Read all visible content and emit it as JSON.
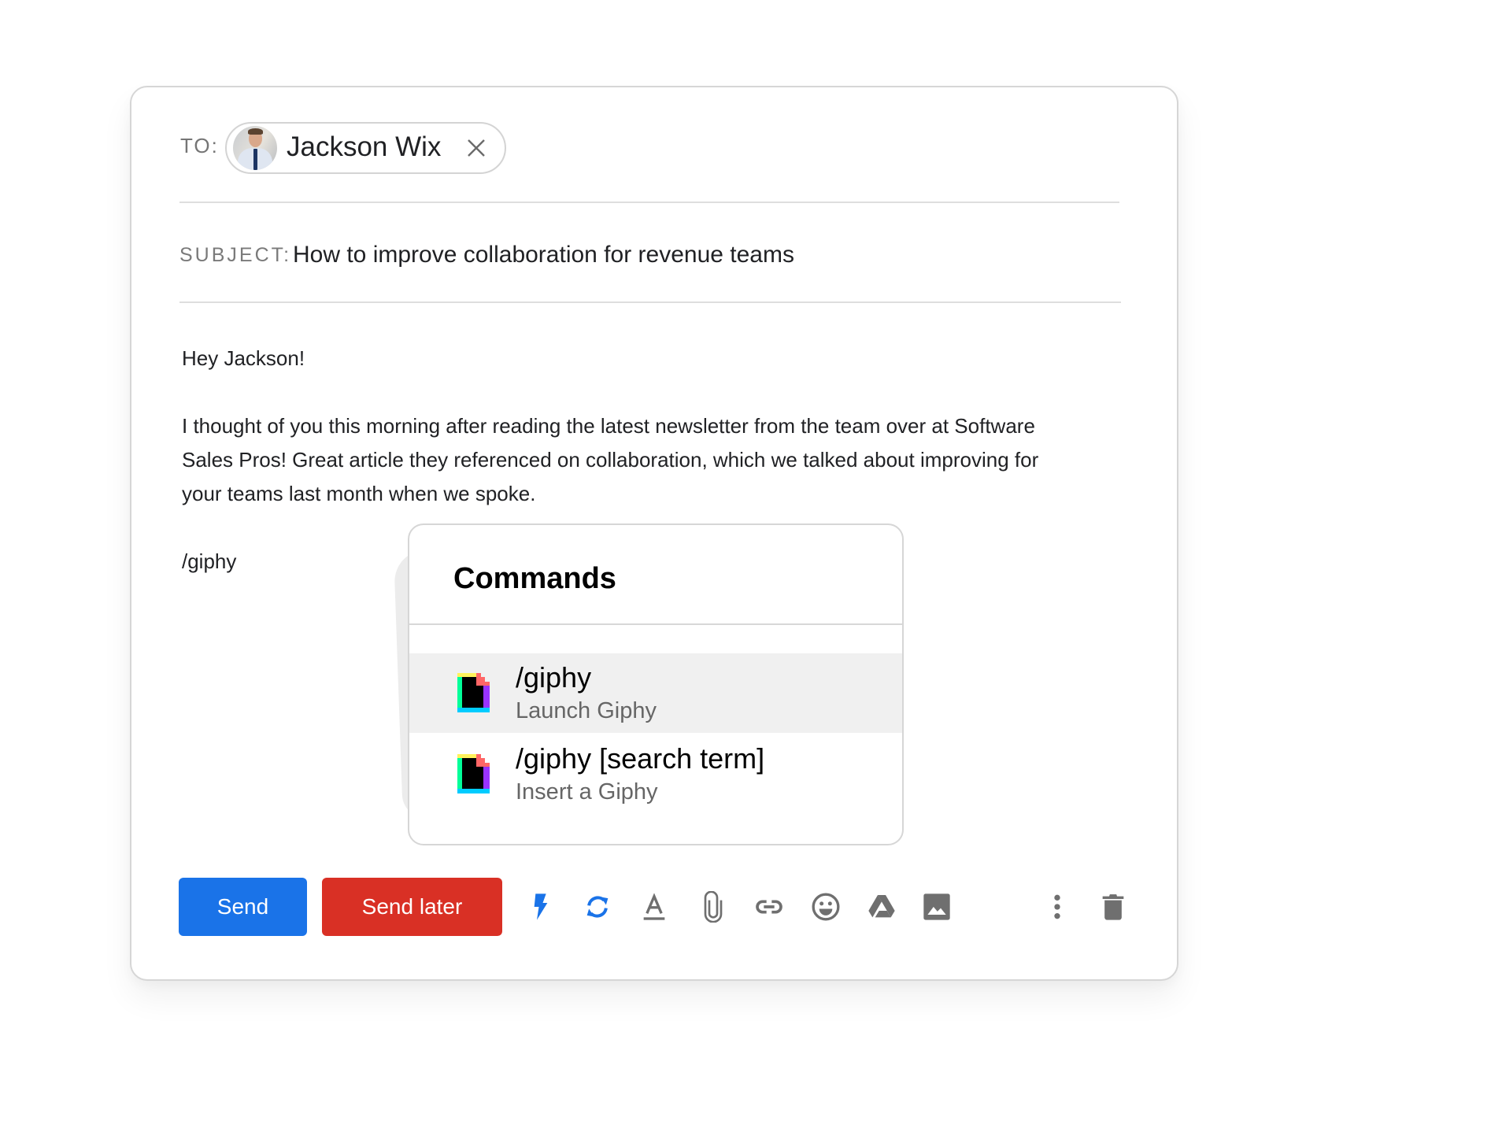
{
  "compose": {
    "to_label": "TO:",
    "recipient": {
      "name": "Jackson Wix",
      "remove_icon": "close-icon"
    },
    "subject_label": "SUBJECT:",
    "subject_value": "How to improve collaboration for revenue teams",
    "body": {
      "greeting": "Hey Jackson!",
      "paragraph_lines": [
        "I thought of you this morning after reading the latest newsletter from the team over at Software",
        "Sales Pros! Great article they referenced on collaboration, which we talked about improving for",
        "your teams last month when we spoke."
      ],
      "command_input": "/giphy"
    }
  },
  "commands_popover": {
    "title": "Commands",
    "items": [
      {
        "title": "/giphy",
        "subtitle": "Launch Giphy",
        "icon": "giphy-icon",
        "highlighted": true
      },
      {
        "title": "/giphy [search term]",
        "subtitle": "Insert a Giphy",
        "icon": "giphy-icon",
        "highlighted": false
      }
    ]
  },
  "toolbar": {
    "send_label": "Send",
    "send_later_label": "Send later",
    "icons": [
      "lightning-icon",
      "sync-icon",
      "text-format-icon",
      "attachment-icon",
      "link-icon",
      "emoji-icon",
      "drive-icon",
      "image-icon",
      "more-vert-icon",
      "trash-icon"
    ]
  },
  "colors": {
    "send": "#1a73e8",
    "send_later": "#d93025",
    "accent_icon": "#1a73e8",
    "icon_grey": "#6f6f6f"
  }
}
